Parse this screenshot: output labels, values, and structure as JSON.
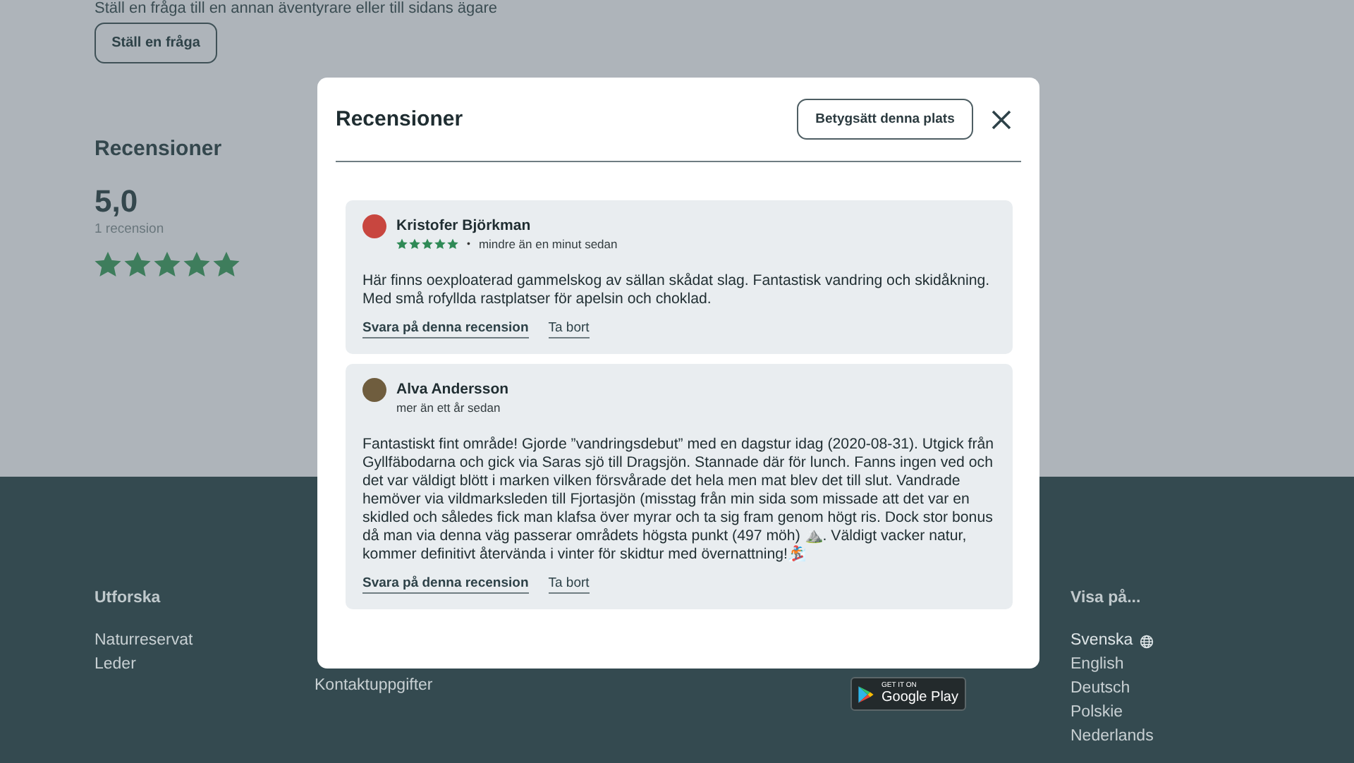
{
  "page": {
    "ask_text": "Ställ en fråga till en annan äventyrare eller till sidans ägare",
    "ask_button": "Ställ en fråga",
    "reviews_title": "Recensioner",
    "score": "5,0",
    "count": "1 recension",
    "stars": 5
  },
  "footer": {
    "columns": [
      {
        "heading": "Utforska",
        "links": [
          "Naturreservat",
          "Leder"
        ]
      },
      {
        "links": [
          "Kontaktuppgifter"
        ]
      }
    ],
    "app_badge": {
      "small": "GET IT ON",
      "big": "Google Play"
    },
    "languages": {
      "heading": "Visa på...",
      "items": [
        {
          "label": "Svenska",
          "selected": true
        },
        {
          "label": "English",
          "selected": false
        },
        {
          "label": "Deutsch",
          "selected": false
        },
        {
          "label": "Polskie",
          "selected": false
        },
        {
          "label": "Nederlands",
          "selected": false
        }
      ]
    }
  },
  "modal": {
    "title": "Recensioner",
    "rate_button": "Betygsätt denna plats",
    "reviews": [
      {
        "author": "Kristofer Björkman",
        "stars": 5,
        "separator": "•",
        "time": "mindre än en minut sedan",
        "text": "Här finns oexploaterad gammelskog av sällan skådat slag. Fantastisk vandring och skidåkning. Med små rofyllda rastplatser för apelsin och choklad.",
        "actions": [
          "Svara på denna recension",
          "Ta bort"
        ]
      },
      {
        "author": "Alva Andersson",
        "time": "mer än ett år sedan",
        "text": "Fantastiskt fint område! Gjorde ”vandringsdebut” med en dagstur idag (2020-08-31). Utgick från Gyllfäbodarna och gick via Saras sjö till Dragsjön. Stannade där för lunch. Fanns ingen ved och det var väldigt blött i marken vilken försvårade det hela men mat blev det till slut. Vandrade hemöver via vildmarksleden till Fjortasjön (misstag från min sida som missade att det var en skidled och således fick man klafsa över myrar och ta sig fram genom högt ris. Dock stor bonus då man via denna väg passerar områdets högsta punkt (497 möh) ⛰️. Väldigt vacker natur, kommer definitivt återvända i vinter för skidtur med övernattning!🏂",
        "actions": [
          "Svara på denna recension",
          "Ta bort"
        ]
      }
    ]
  }
}
